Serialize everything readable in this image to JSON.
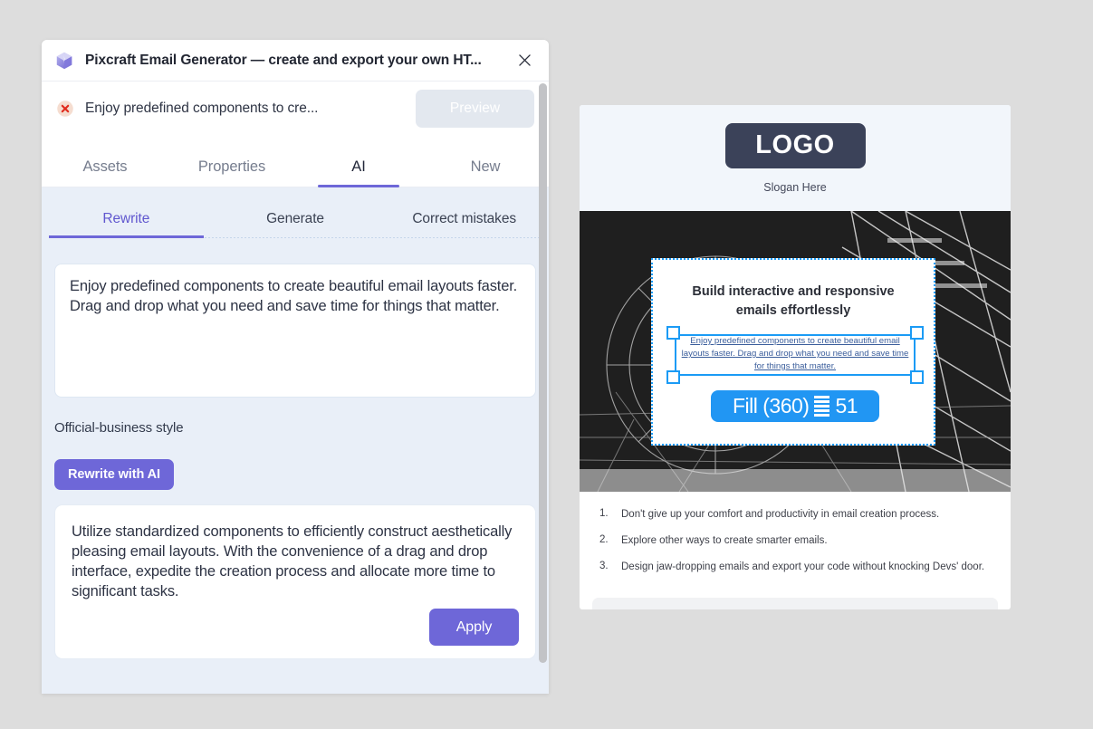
{
  "window": {
    "title": "Pixcraft Email Generator — create and export your own HT...",
    "app_icon": "cube-icon",
    "close_icon": "close-icon"
  },
  "notification": {
    "icon": "error-circle-icon",
    "text": "Enjoy predefined components to cre...",
    "preview_button": "Preview"
  },
  "main_tabs": [
    {
      "label": "Assets",
      "active": false
    },
    {
      "label": "Properties",
      "active": false
    },
    {
      "label": "AI",
      "active": true
    },
    {
      "label": "New",
      "active": false
    }
  ],
  "sub_tabs": [
    {
      "label": "Rewrite",
      "active": true
    },
    {
      "label": "Generate",
      "active": false
    },
    {
      "label": "Correct mistakes",
      "active": false
    }
  ],
  "source": {
    "value": "Enjoy predefined components to create beautiful email layouts faster. Drag and drop what you need and save time for things that matter."
  },
  "style_select": {
    "value": "Official-business style",
    "chevron_icon": "chevron-down-icon"
  },
  "rewrite_button": "Rewrite with AI",
  "result": {
    "text": "Utilize standardized components to efficiently construct aesthetically pleasing email layouts. With the convenience of a drag and drop interface, expedite the creation process and allocate more time to significant tasks.",
    "apply_button": "Apply"
  },
  "email_preview": {
    "logo": "LOGO",
    "slogan": "Slogan Here",
    "card": {
      "heading": "Build interactive and responsive emails effortlessly",
      "body": "Enjoy predefined components to create beautiful email layouts faster. Drag and drop what you need and save time for things that matter.",
      "fill_label": "Fill (360)",
      "fill_value": "51"
    },
    "list": [
      {
        "num": "1.",
        "text": "Don't give up your comfort and productivity in email creation process."
      },
      {
        "num": "2.",
        "text": "Explore other ways to create smarter emails."
      },
      {
        "num": "3.",
        "text": "Design jaw-dropping emails and export your code without knocking Devs' door."
      }
    ]
  },
  "colors": {
    "accent_purple": "#6e67d8",
    "selection_blue": "#1b9bf5",
    "fill_blue": "#2196f3",
    "logo_navy": "#3b4259",
    "panel_bg": "#e9eff8",
    "desktop_bg": "#dddddd"
  }
}
